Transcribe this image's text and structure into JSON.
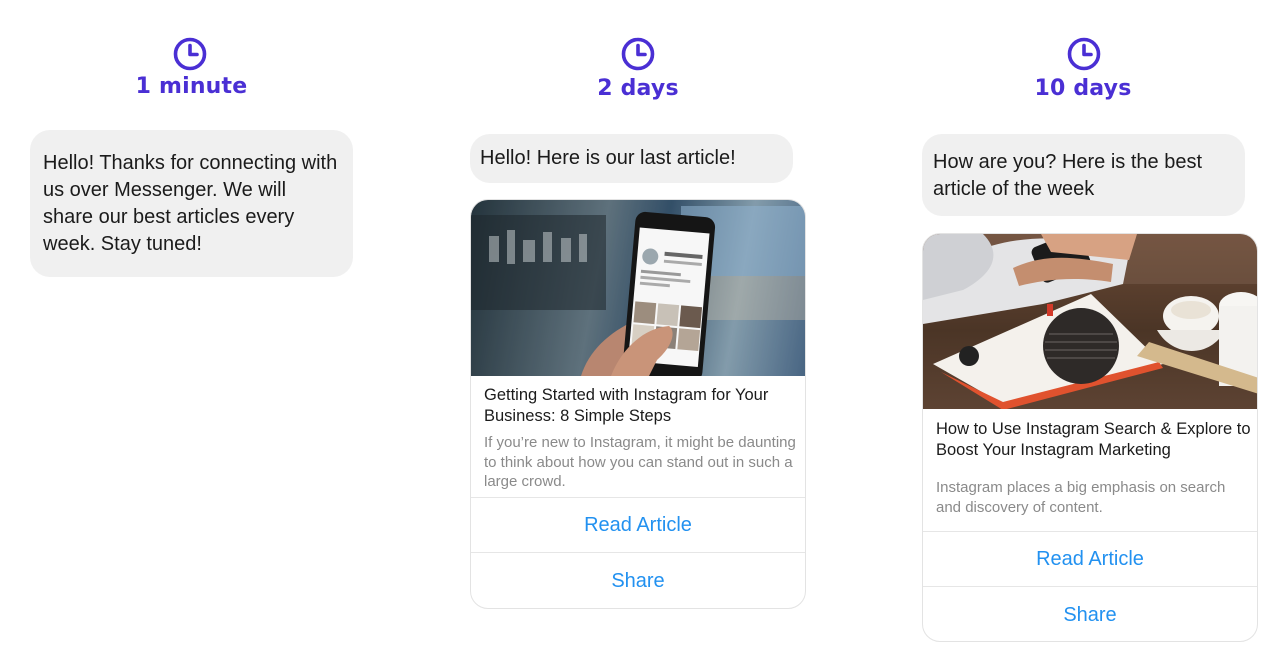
{
  "colors": {
    "accent": "#4a2fd4",
    "bubble_bg": "#f0f0f0",
    "link": "#2291f0",
    "muted_text": "#8a8a8a"
  },
  "steps": [
    {
      "icon": "clock-icon",
      "time": "1 minute",
      "message": "Hello! Thanks for connecting with us over Messenger. We will share our best articles every week. Stay tuned!"
    },
    {
      "icon": "clock-icon",
      "time": "2 days",
      "message": "Hello! Here is our last article!",
      "card": {
        "image": "Hand holding a smartphone showing an Instagram profile",
        "title": "Getting Started with Instagram for Your Business: 8 Simple Steps",
        "description": "If you’re new to Instagram, it might be daunting to think about how you can stand out in such a large crowd.",
        "buttons": [
          "Read Article",
          "Share"
        ]
      }
    },
    {
      "icon": "clock-icon",
      "time": "10 days",
      "message": "How are you? Here is the best article of the week",
      "card": {
        "image": "Hands holding a phone over a magazine and coffee cups",
        "title": "How to Use Instagram Search & Explore to Boost Your Instagram Marketing",
        "description": "Instagram places a big emphasis on search and discovery of content.",
        "buttons": [
          "Read Article",
          "Share"
        ]
      }
    }
  ]
}
